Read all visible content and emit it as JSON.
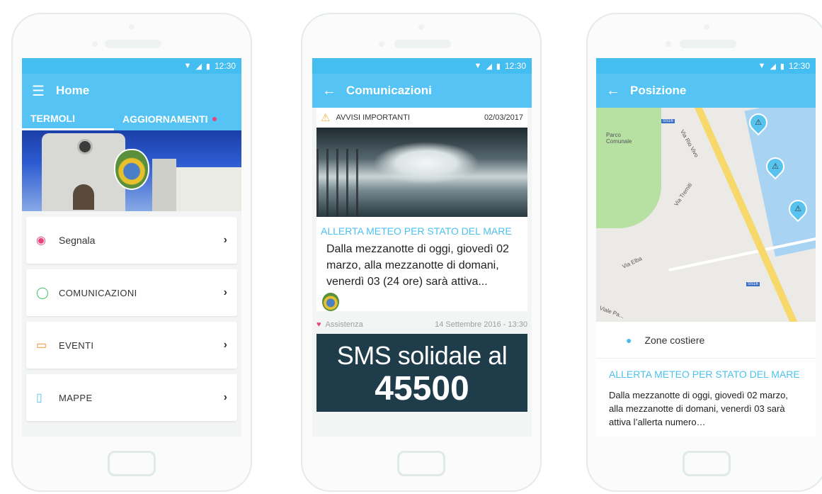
{
  "status": {
    "time": "12:30",
    "signal_icon": "wifi-icon",
    "battery_icon": "battery-icon"
  },
  "phone1": {
    "title": "Home",
    "tabs": [
      {
        "label": "TERMOLI"
      },
      {
        "label": "AGGIORNAMENTI"
      }
    ],
    "menu": [
      {
        "label": "Segnala",
        "icon": "location-pin-icon",
        "color": "#e8457b"
      },
      {
        "label": "COMUNICAZIONI",
        "icon": "chat-bubble-icon",
        "color": "#46c46a"
      },
      {
        "label": "EVENTI",
        "icon": "calendar-icon",
        "color": "#f08a2e"
      },
      {
        "label": "MAPPE",
        "icon": "map-icon",
        "color": "#58c3ef"
      }
    ]
  },
  "phone2": {
    "title": "Comunicazioni",
    "card1": {
      "category": "AVVISI IMPORTANTI",
      "date": "02/03/2017",
      "title": "ALLERTA METEO PER STATO DEL MARE",
      "text": "Dalla mezzanotte di oggi, giovedì 02 marzo, alla mezzanotte di domani, venerdì 03 (24 ore) sarà attiva..."
    },
    "card2": {
      "category": "Assistenza",
      "date": "14 Settembre 2016 - 13:30",
      "banner_line1": "SMS solidale al",
      "banner_line2": "45500"
    }
  },
  "phone3": {
    "title": "Posizione",
    "map_labels": {
      "park": "Parco\nComunale",
      "via_rio_vivo": "Via Rio Vivo",
      "via_tremiti": "Via Tremiti",
      "via_elba": "Via Elba",
      "viale": "Viale Pa...",
      "ss16_a": "SS16",
      "ss16_b": "SS16"
    },
    "zone": "Zone costiere",
    "alert_title": "ALLERTA METEO PER STATO DEL MARE",
    "alert_text": "Dalla mezzanotte di oggi, giovedì 02 marzo, alla mezzanotte di domani, venerdì 03 sarà attiva l’allerta numero…"
  },
  "colors": {
    "appbar": "#55c3f3",
    "statusbar": "#44bdf0",
    "accent_text": "#4cc1ef",
    "pink_badge": "#e8457b"
  }
}
